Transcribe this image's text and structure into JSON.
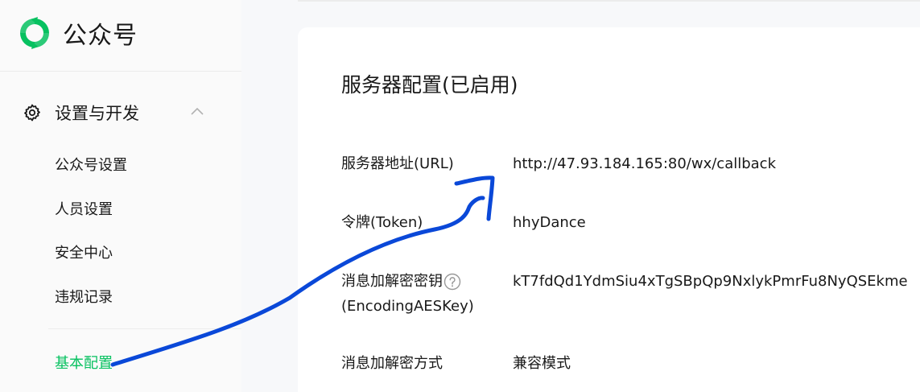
{
  "app": {
    "name": "公众号",
    "brand_color": "#07c160"
  },
  "sidebar": {
    "group": {
      "title": "设置与开发",
      "icon": "gear-icon",
      "expanded": true
    },
    "items": [
      {
        "label": "公众号设置",
        "active": false
      },
      {
        "label": "人员设置",
        "active": false
      },
      {
        "label": "安全中心",
        "active": false
      },
      {
        "label": "违规记录",
        "active": false
      },
      {
        "label": "基本配置",
        "active": true
      }
    ]
  },
  "main": {
    "section_title": "服务器配置(已启用)",
    "fields": [
      {
        "label": "服务器地址(URL)",
        "value": "http://47.93.184.165:80/wx/callback"
      },
      {
        "label": "令牌(Token)",
        "value": "hhyDance"
      },
      {
        "label_line1": "消息加解密密钥",
        "label_line2": "(EncodingAESKey)",
        "help_icon": "question-circle-icon",
        "value": "kT7fdQd1YdmSiu4xTgSBpQp9NxlykPmrFu8NyQSEkme"
      },
      {
        "label": "消息加解密方式",
        "value": "兼容模式"
      }
    ]
  },
  "annotation": {
    "color": "#0a48d8"
  }
}
